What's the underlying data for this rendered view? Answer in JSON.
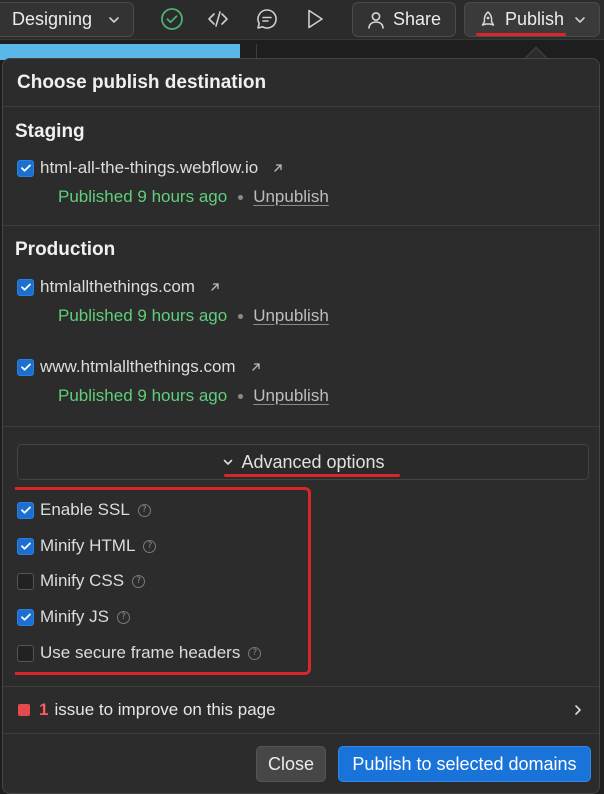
{
  "topbar": {
    "mode_label": "Designing",
    "share_label": "Share",
    "publish_label": "Publish"
  },
  "popover": {
    "title": "Choose publish destination",
    "staging": {
      "title": "Staging",
      "domains": [
        {
          "domain": "html-all-the-things.webflow.io",
          "checked": true,
          "status": "Published 9 hours ago",
          "unpublish": "Unpublish"
        }
      ]
    },
    "production": {
      "title": "Production",
      "domains": [
        {
          "domain": "htmlallthethings.com",
          "checked": true,
          "status": "Published 9 hours ago",
          "unpublish": "Unpublish"
        },
        {
          "domain": "www.htmlallthethings.com",
          "checked": true,
          "status": "Published 9 hours ago",
          "unpublish": "Unpublish"
        }
      ]
    },
    "advanced_label": "Advanced options",
    "options": [
      {
        "label": "Enable SSL",
        "checked": true
      },
      {
        "label": "Minify HTML",
        "checked": true
      },
      {
        "label": "Minify CSS",
        "checked": false
      },
      {
        "label": "Minify JS",
        "checked": true
      },
      {
        "label": "Use secure frame headers",
        "checked": false
      }
    ],
    "help_glyph": "?",
    "issue": {
      "count": "1",
      "text": "issue to improve on this page"
    },
    "close_label": "Close",
    "publish_selected_label": "Publish to selected domains"
  },
  "colors": {
    "accent_blue": "#1a73d8",
    "published_green": "#5fcf7a",
    "annotation_red": "#d8262c",
    "issue_red": "#e5484d"
  }
}
